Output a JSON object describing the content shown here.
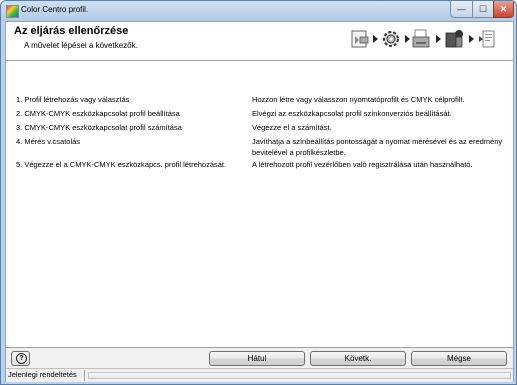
{
  "window": {
    "title": "Color Centro profil.",
    "minimize_glyph": "—",
    "maximize_glyph": "☐",
    "close_glyph": "✕"
  },
  "header": {
    "title": "Az eljárás ellenőrzése",
    "subtitle": "A művelet lépései a következők.",
    "step_icons": [
      "printer-profile-icon",
      "gear-icon",
      "printer-icon",
      "scanner-icon",
      "document-icon"
    ]
  },
  "steps": [
    {
      "label": "1. Profil létrehozás vagy választás",
      "description": "Hozzon létre vagy válasszon nyomtatóprofilt és CMYK célprofilt."
    },
    {
      "label": "2. CMYK-CMYK eszközkapcsolat profil beállítása",
      "description": "Elvégzi az eszközkapcsolat profil színkonverziós beállítását."
    },
    {
      "label": "3. CMYK-CMYK eszközkapcsolat profil számítása",
      "description": "Végezze el a számítást."
    },
    {
      "label": "4. Mérés v.csatolás",
      "description": "Javíthatja a színbeállítás pontosságát a nyomat mérésével és az eredmény bevitelével a profilkészletbe."
    },
    {
      "label": "5. Végezze el a CMYK-CMYK eszközkapcs. profil létrehozását.",
      "description": "A létrehozott profil vezérlőben való regisztrálása után használható."
    }
  ],
  "footer": {
    "help_glyph": "?",
    "back_label": "Hátul",
    "next_label": "Követk.",
    "cancel_label": "Mégse"
  },
  "statusbar": {
    "text": "Jelenlegi rendeltetés"
  }
}
